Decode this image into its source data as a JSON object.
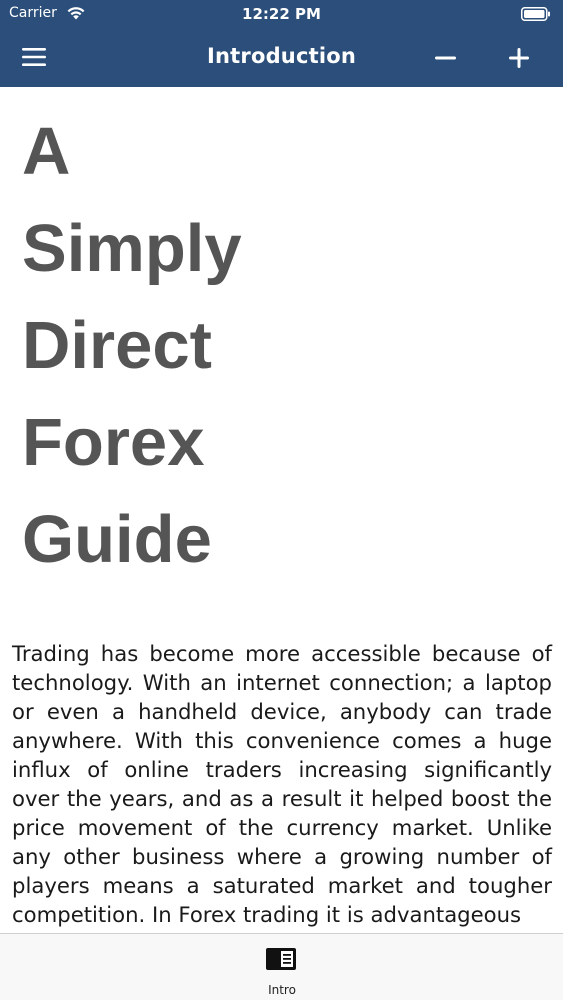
{
  "status_bar": {
    "carrier": "Carrier",
    "time": "12:22 PM",
    "icons": [
      "wifi-icon",
      "battery-icon"
    ]
  },
  "navbar": {
    "title": "Introduction",
    "menu_icon": "hamburger-menu-icon",
    "zoom_out_icon": "minus-icon",
    "zoom_in_icon": "plus-icon",
    "background_color": "#2b4f7a"
  },
  "content": {
    "title_lines": [
      "A",
      "Simply",
      "Direct",
      "Forex",
      "Guide"
    ],
    "paragraph": "Trading has become more accessible because of technology. With an internet connection; a laptop or even a handheld device, anybody can trade anywhere. With this convenience comes a huge influx of online traders increasing significantly over the years, and as a result it helped boost the price movement of the currency market. Unlike any other business where a growing number of players means a saturated market and tougher competition. In Forex trading it is advantageous",
    "title_color": "#555555"
  },
  "tab_bar": {
    "tabs": [
      {
        "label": "Intro",
        "icon": "book-icon"
      }
    ]
  }
}
